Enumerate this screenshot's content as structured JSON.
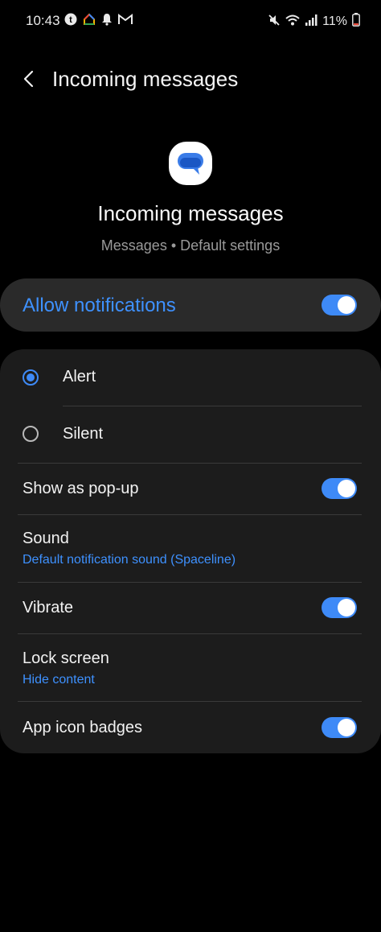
{
  "status_bar": {
    "time": "10:43",
    "left_icons": [
      "t-badge-icon",
      "home-icon",
      "bell-icon",
      "gmail-icon"
    ],
    "right_icons": [
      "mute-icon",
      "wifi-icon",
      "signal-icon"
    ],
    "battery": "11%"
  },
  "header": {
    "title": "Incoming messages"
  },
  "hero": {
    "title": "Incoming messages",
    "subtitle": "Messages • Default settings"
  },
  "allow": {
    "label": "Allow notifications",
    "enabled": true
  },
  "alert_mode": {
    "options": [
      {
        "label": "Alert",
        "selected": true
      },
      {
        "label": "Silent",
        "selected": false
      }
    ]
  },
  "settings": {
    "popup": {
      "label": "Show as pop-up",
      "enabled": true
    },
    "sound": {
      "label": "Sound",
      "value": "Default notification sound (Spaceline)"
    },
    "vibrate": {
      "label": "Vibrate",
      "enabled": true
    },
    "lock_screen": {
      "label": "Lock screen",
      "value": "Hide content"
    },
    "badges": {
      "label": "App icon badges",
      "enabled": true
    }
  },
  "colors": {
    "accent": "#3e8af7",
    "card": "#1c1c1c",
    "allow_card": "#2a2a2a",
    "background": "#000000"
  }
}
